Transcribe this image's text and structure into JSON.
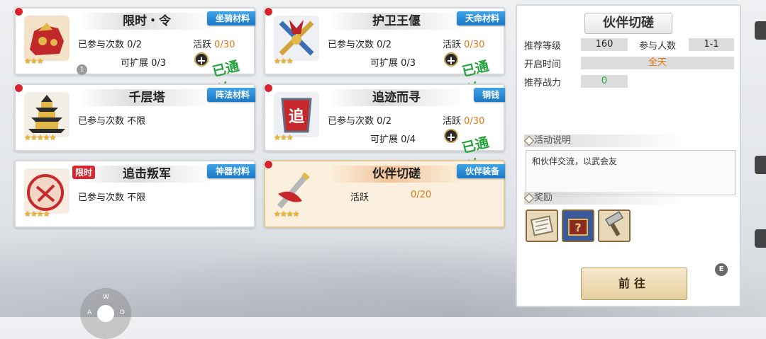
{
  "cards": [
    {
      "title": "限时・令",
      "tag": "坐骑材料",
      "participate_label": "已参与次数",
      "participate_value": "0/2",
      "active_label": "活跃",
      "active_value": "0/30",
      "expand_label": "可扩展",
      "expand_value": "0/3",
      "stamp": "已通关",
      "badge": "1",
      "stars": "★★★"
    },
    {
      "title": "护卫王偃",
      "tag": "天命材料",
      "participate_label": "已参与次数",
      "participate_value": "0/2",
      "active_label": "活跃",
      "active_value": "0/30",
      "expand_label": "可扩展",
      "expand_value": "0/3",
      "stamp": "已通关",
      "stars": "★★★"
    },
    {
      "title": "千层塔",
      "tag": "阵法材料",
      "participate_label": "已参与次数",
      "participate_value": "不限",
      "stars": "★★★★★"
    },
    {
      "title": "追迹而寻",
      "tag": "铜钱",
      "participate_label": "已参与次数",
      "participate_value": "0/2",
      "active_label": "活跃",
      "active_value": "0/30",
      "expand_label": "可扩展",
      "expand_value": "0/4",
      "stamp": "已通关",
      "icon_char": "追",
      "stars": "★★★"
    },
    {
      "title": "追击叛军",
      "tag": "神器材料",
      "participate_label": "已参与次数",
      "participate_value": "不限",
      "limited": "限时",
      "stars": "★★★★"
    },
    {
      "title": "伙伴切磋",
      "tag": "伙伴装备",
      "active_label": "活跃",
      "active_value": "0/20",
      "stars": "★★★★"
    }
  ],
  "panel": {
    "title": "伙伴切磋",
    "level_label": "推荐等级",
    "level_value": "160",
    "players_label": "参与人数",
    "players_value": "1-1",
    "time_label": "开启时间",
    "time_value": "全天",
    "power_label": "推荐战力",
    "power_value": "0",
    "desc_head": "活动说明",
    "desc_text": "和伙伴交流，以武会友",
    "reward_head": "奖励",
    "rewards": [
      "scroll-icon",
      "mystery-box-icon",
      "hammer-icon"
    ],
    "go_button": "前往",
    "e_key": "E"
  },
  "joystick": {
    "up": "W",
    "left": "A",
    "right": "D"
  },
  "colors": {
    "accent_orange": "#e07a10",
    "tag_blue": "#1d78c6",
    "stamp_green": "#22a33a",
    "red_dot": "#d8232a",
    "power_green": "#22a33a"
  }
}
